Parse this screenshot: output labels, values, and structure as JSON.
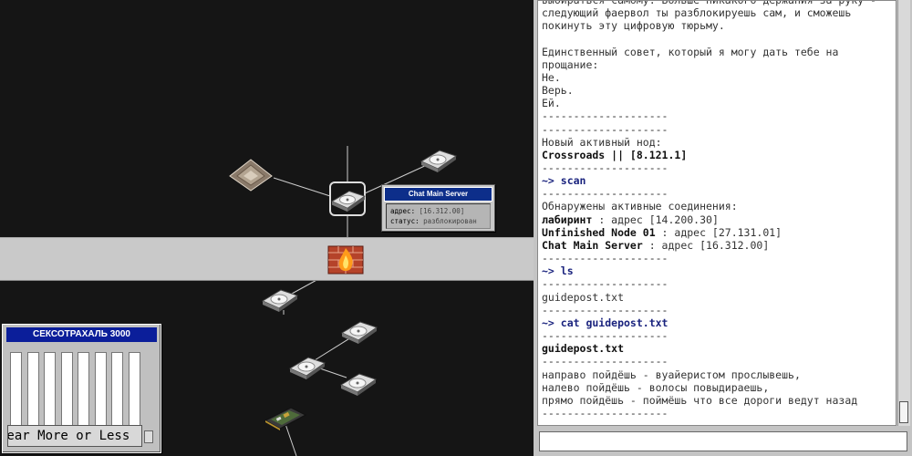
{
  "map": {
    "nodes": [
      {
        "id": "pyramid",
        "icon": "pyramid-node-icon"
      },
      {
        "id": "top-right-disk",
        "icon": "hard-drive-icon"
      },
      {
        "id": "chat-main-server",
        "icon": "hard-drive-icon",
        "selected": true
      },
      {
        "id": "firewall",
        "icon": "firewall-icon"
      },
      {
        "id": "below-firewall-disk",
        "icon": "hard-drive-icon"
      },
      {
        "id": "mid-disk-1",
        "icon": "hard-drive-icon"
      },
      {
        "id": "mid-disk-2",
        "icon": "hard-drive-icon"
      },
      {
        "id": "mid-disk-3",
        "icon": "hard-drive-icon"
      },
      {
        "id": "sound-card",
        "icon": "sound-card-icon"
      }
    ],
    "tooltip": {
      "title": "Chat Main Server",
      "address_label": "адрес:",
      "address_value": "[16.312.00]",
      "status_label": "статус:",
      "status_value": "разблокирован"
    }
  },
  "widget": {
    "title": "СЕКСОТРАХАЛЬ 3000",
    "bars": [
      0.0,
      0.12,
      0.0,
      0.0,
      0.0,
      0.0,
      0.0,
      0.0
    ],
    "button_label": "Fear More or Less",
    "accent": "#a8461a"
  },
  "terminal": {
    "lines": [
      {
        "text": "выбираться самому. Больше никакого держания за руку -"
      },
      {
        "text": "следующий фаервол ты разблокируешь сам, и сможешь"
      },
      {
        "text": "покинуть эту цифровую тюрьму."
      },
      {
        "text": ""
      },
      {
        "text": "Единственный совет, который я могу дать тебе на"
      },
      {
        "text": "прощание:"
      },
      {
        "text": "Не."
      },
      {
        "text": "Верь."
      },
      {
        "text": "Ей."
      },
      {
        "text": "--------------------"
      },
      {
        "text": "--------------------"
      },
      {
        "text": "Новый активный нод:"
      },
      {
        "text": "Crossroads || [8.121.1]",
        "bold": true
      },
      {
        "text": "--------------------"
      },
      {
        "text": "~> scan",
        "prompt": true
      },
      {
        "text": "--------------------"
      },
      {
        "text": "Обнаружены активные соединения:"
      },
      {
        "bold_part": "лабиринт",
        "rest": " : адрес [14.200.30]"
      },
      {
        "bold_part": "Unfinished Node 01",
        "rest": " : адрес [27.131.01]"
      },
      {
        "bold_part": "Chat Main Server",
        "rest": " : адрес [16.312.00]"
      },
      {
        "text": "--------------------"
      },
      {
        "text": "~> ls",
        "prompt": true
      },
      {
        "text": "--------------------"
      },
      {
        "text": "guidepost.txt"
      },
      {
        "text": "--------------------"
      },
      {
        "text": "~> cat guidepost.txt",
        "prompt": true
      },
      {
        "text": "--------------------"
      },
      {
        "text": "guidepost.txt",
        "bold": true
      },
      {
        "text": "--------------------"
      },
      {
        "text": "направо пойдёшь - вуайеристом прослывешь,"
      },
      {
        "text": "налево пойдёшь - волосы повыдираешь,"
      },
      {
        "text": "прямо пойдёшь - поймёшь что все дороги ведут назад"
      },
      {
        "text": "--------------------"
      }
    ],
    "input_value": ""
  }
}
